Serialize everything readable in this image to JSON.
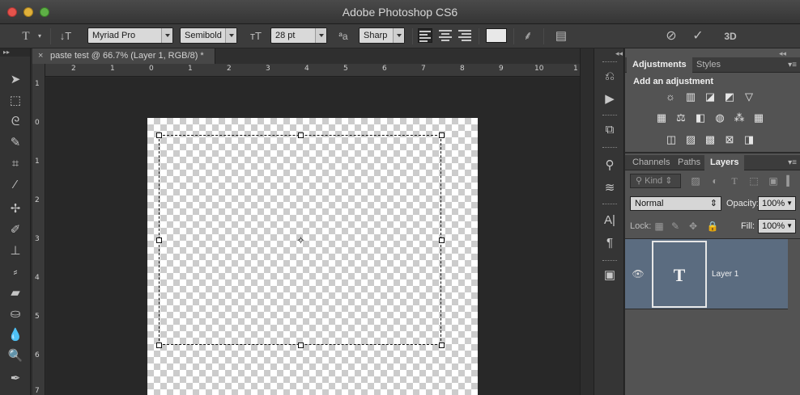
{
  "window": {
    "title": "Adobe Photoshop CS6"
  },
  "options_bar": {
    "font_family": "Myriad Pro",
    "font_style": "Semibold",
    "font_size": "28 pt",
    "antialias_icon_text": "ªa",
    "antialias": "Sharp",
    "text_color": "#e8e8e8",
    "mode_3d": "3D"
  },
  "document": {
    "tab_title": "paste test @ 66.7% (Layer 1, RGB/8) *",
    "ruler_h": [
      "2",
      "1",
      "0",
      "1",
      "2",
      "3",
      "4",
      "5",
      "6",
      "7",
      "8",
      "9",
      "10",
      "1"
    ],
    "ruler_v": [
      "1",
      "0",
      "1",
      "2",
      "3",
      "4",
      "5",
      "6",
      "7"
    ]
  },
  "adjustments_panel": {
    "tabs": [
      "Adjustments",
      "Styles"
    ],
    "active_tab": "Adjustments",
    "heading": "Add an adjustment"
  },
  "layers_panel": {
    "tabs": [
      "Channels",
      "Paths",
      "Layers"
    ],
    "active_tab": "Layers",
    "filter_kind": "Kind",
    "blend_mode": "Normal",
    "opacity_label": "Opacity:",
    "opacity_value": "100%",
    "lock_label": "Lock:",
    "fill_label": "Fill:",
    "fill_value": "100%",
    "layers": [
      {
        "name": "Layer 1",
        "thumb_text": "T",
        "visible": true,
        "selected": true
      }
    ]
  },
  "colors": {
    "selected_layer": "#5b6c80",
    "panel_bg": "#535353",
    "app_bg": "#2b2b2b"
  }
}
